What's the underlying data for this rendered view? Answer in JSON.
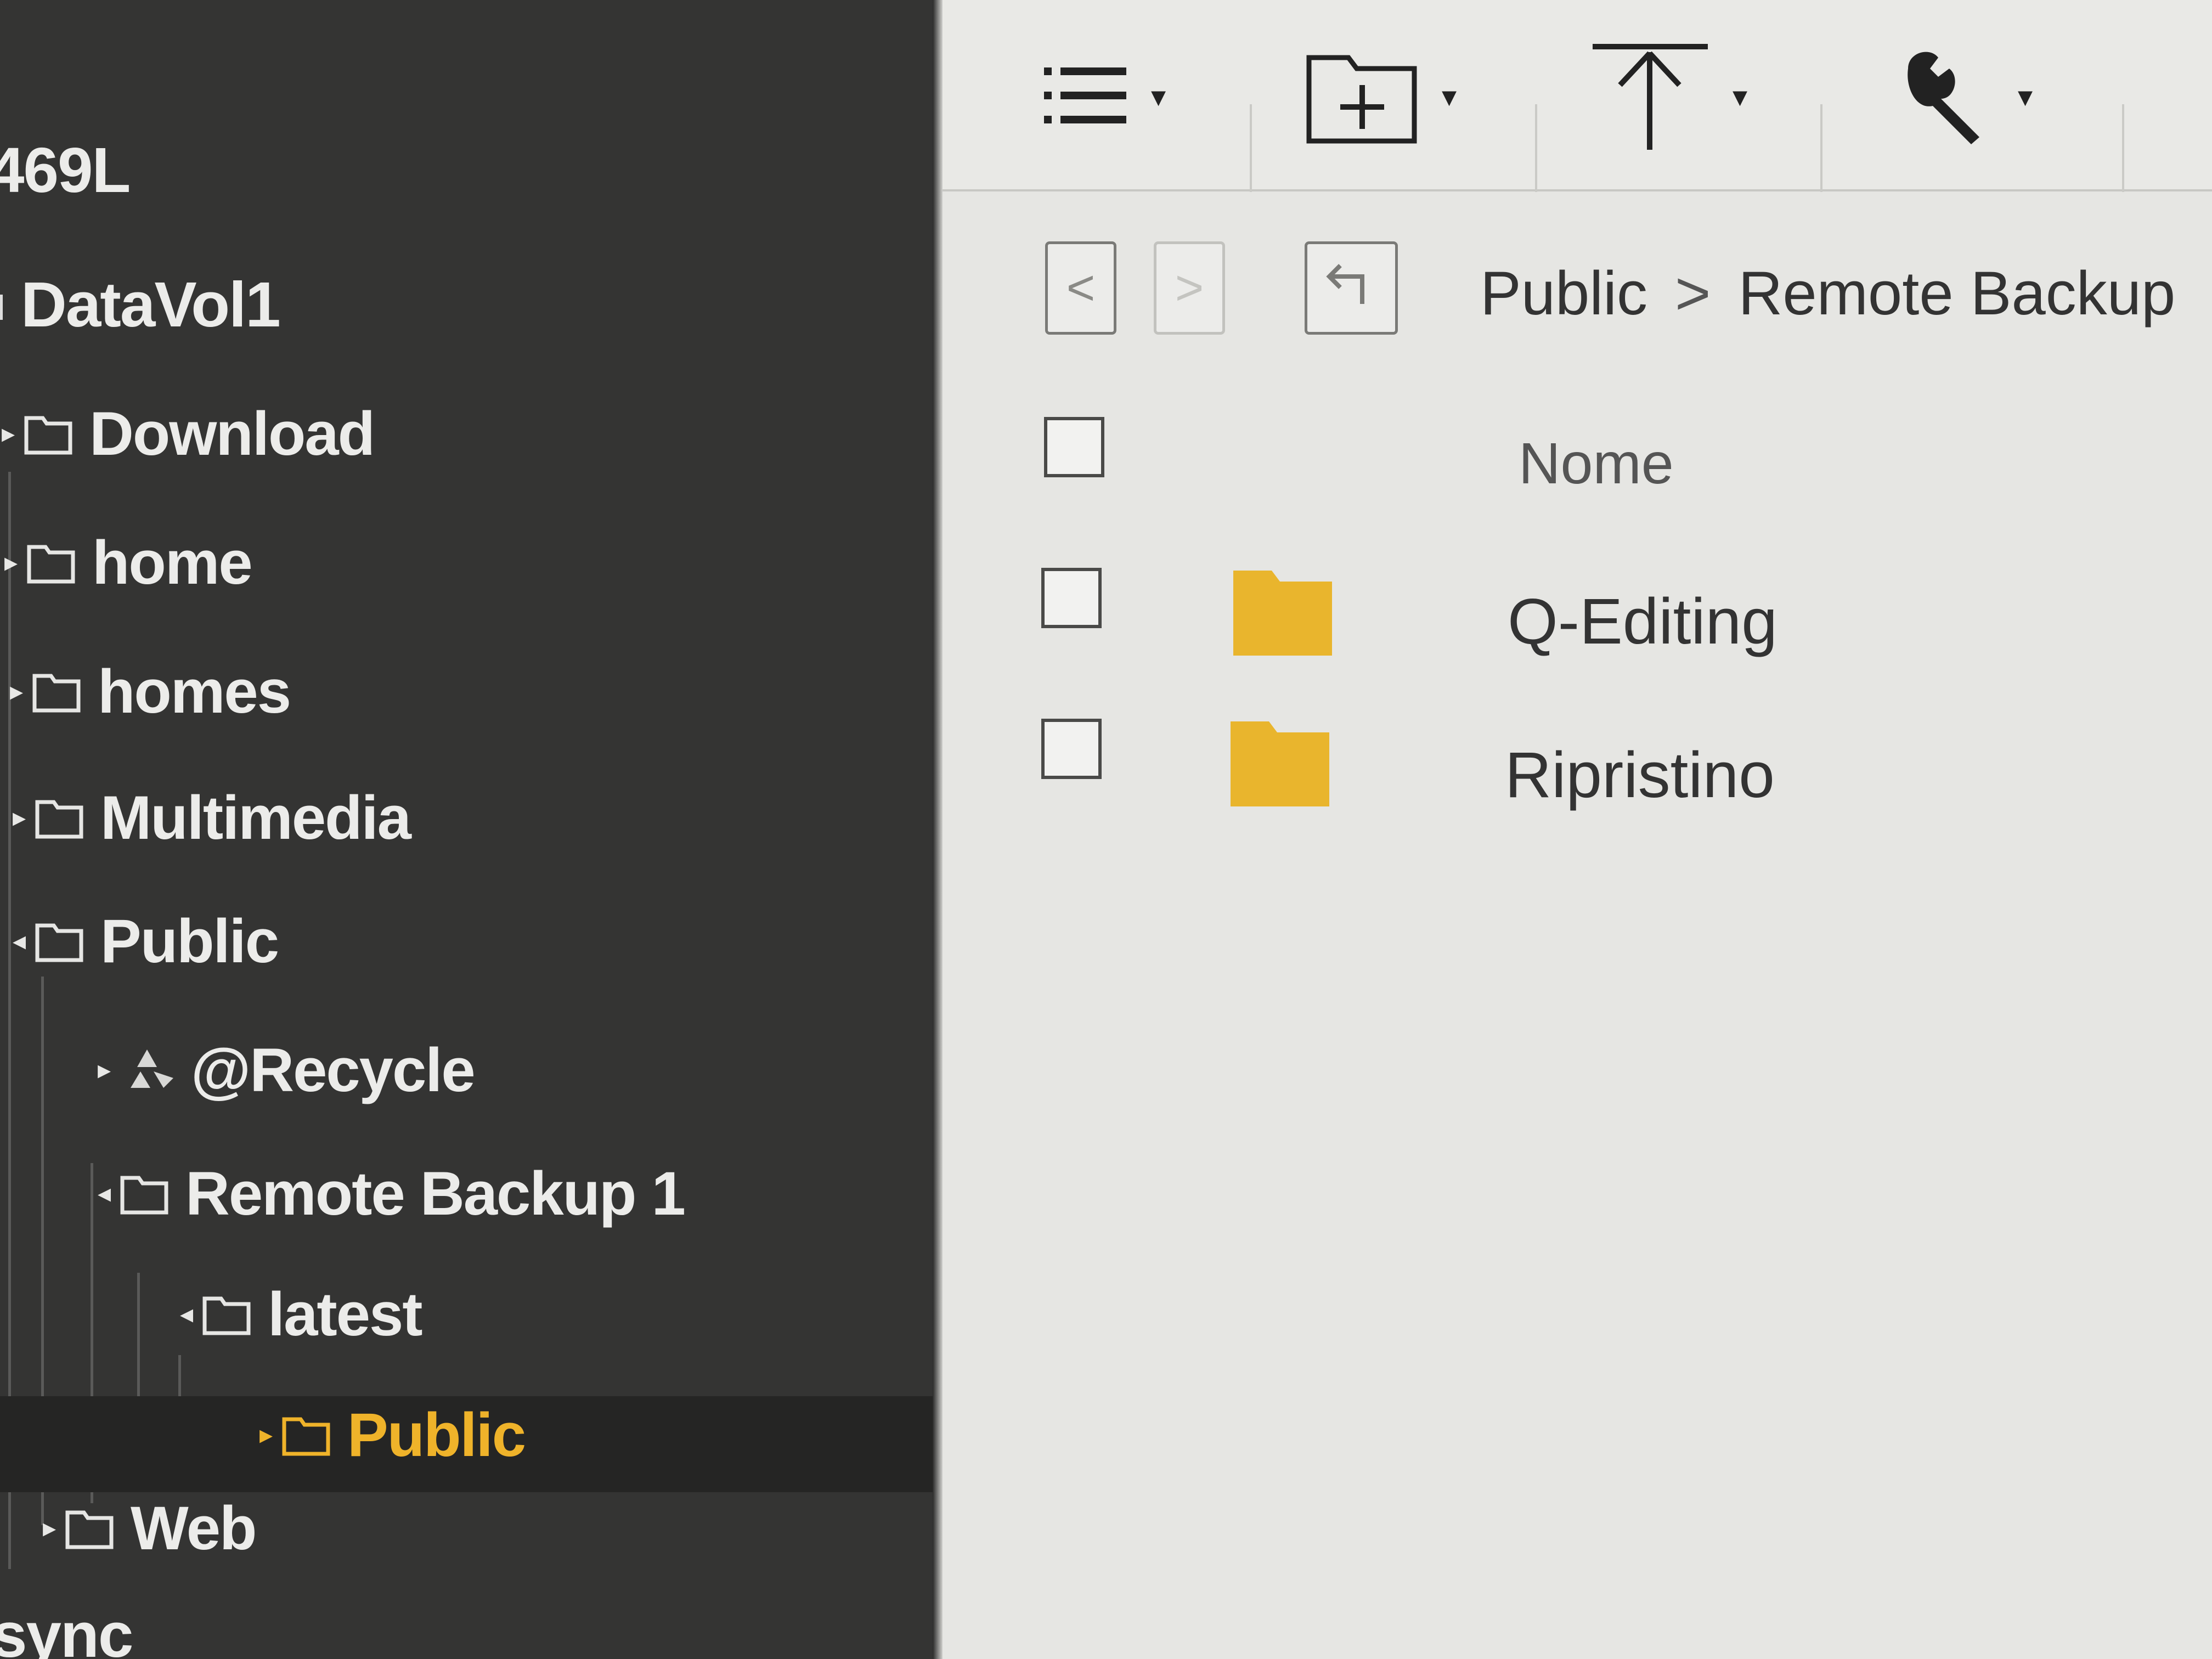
{
  "sidebar": {
    "header_label": "469L",
    "volume_label": "DataVol1",
    "tree": [
      {
        "label": "Download",
        "caret": "▸"
      },
      {
        "label": "home",
        "caret": "▸"
      },
      {
        "label": "homes",
        "caret": "▸"
      },
      {
        "label": "Multimedia",
        "caret": "▸"
      },
      {
        "label": "Public",
        "caret": "◂"
      },
      {
        "label": "@Recycle",
        "caret": "▸"
      },
      {
        "label": "Remote Backup 1",
        "caret": "◂"
      },
      {
        "label": "latest",
        "caret": "◂"
      },
      {
        "label": "Public",
        "caret": "▸",
        "selected": true
      },
      {
        "label": "Web",
        "caret": "▸"
      }
    ],
    "footer_label": "sync"
  },
  "toolbar": {
    "caret": "▾",
    "icons": [
      "list-view-icon",
      "new-folder-icon",
      "upload-icon",
      "wrench-icon"
    ]
  },
  "nav": {
    "back_glyph": "<",
    "forward_glyph": ">",
    "up_icon": "parent-folder-icon",
    "breadcrumb": [
      "Public",
      "Remote Backup"
    ],
    "breadcrumb_sep": ">"
  },
  "file_list": {
    "column_name": "Nome",
    "rows": [
      {
        "name": "Q-Editing",
        "type": "folder"
      },
      {
        "name": "Ripristino",
        "type": "folder"
      }
    ]
  },
  "colors": {
    "sidebar_bg": "#343433",
    "selected_text": "#efb32a",
    "folder_yellow": "#e9b52d",
    "main_bg": "#e6e6e3"
  }
}
